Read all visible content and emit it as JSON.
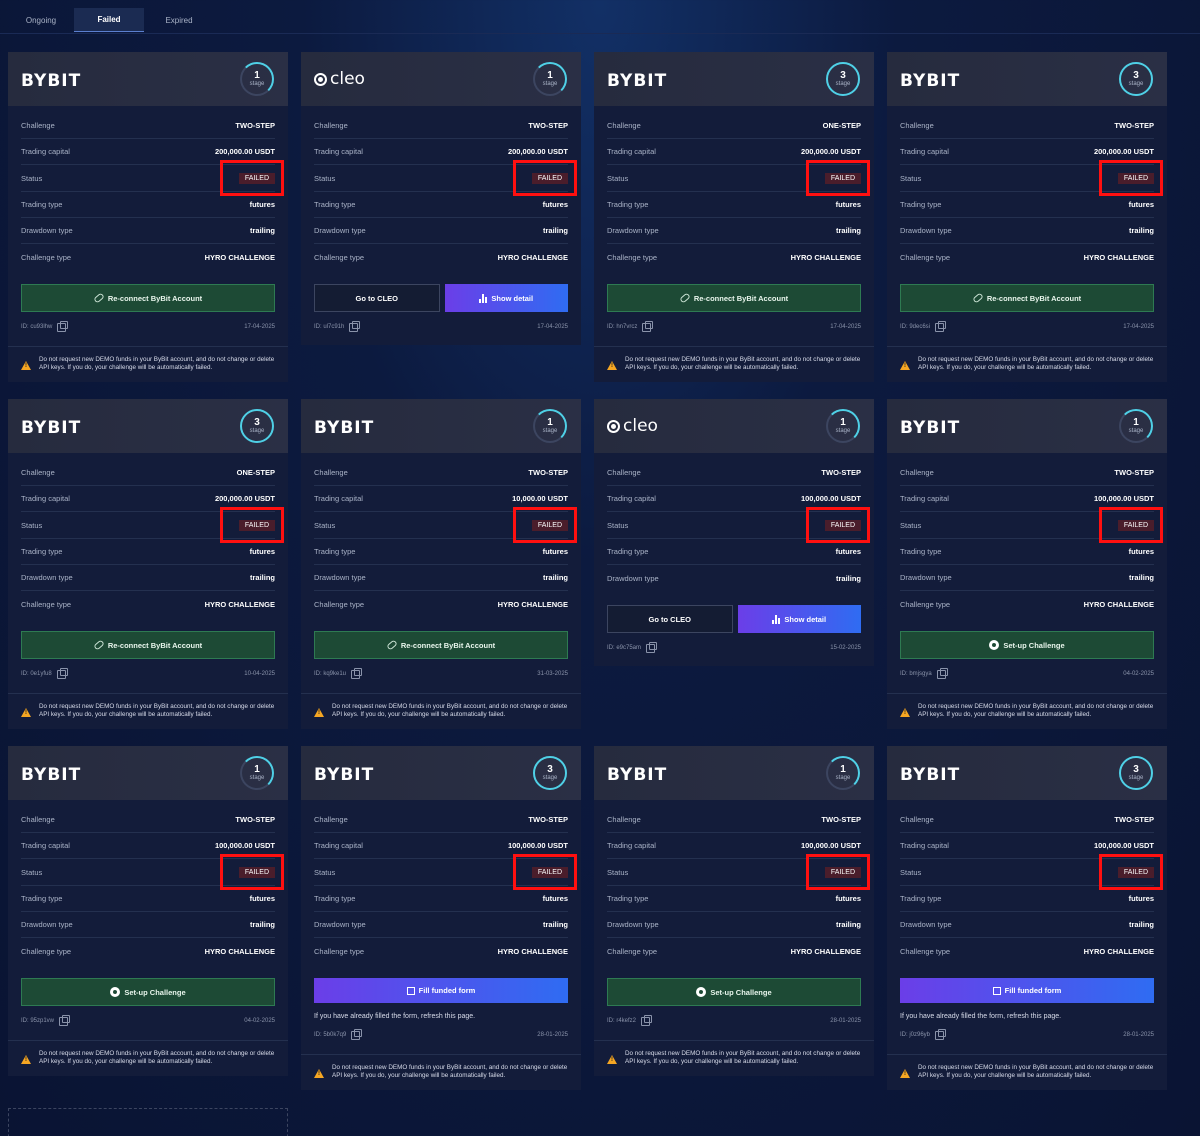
{
  "tabs": [
    "Ongoing",
    "Failed",
    "Expired"
  ],
  "active_tab": "Failed",
  "labels": {
    "stage": "stage",
    "challenge": "Challenge",
    "trading_capital": "Trading capital",
    "status": "Status",
    "trading_type": "Trading type",
    "drawdown_type": "Drawdown type",
    "challenge_type": "Challenge type",
    "warning": "Do not request new DEMO funds in your ByBit account, and do not change or delete API keys. If you do, your challenge will be automatically failed.",
    "funded_note": "If you have already filled the form, refresh this page."
  },
  "cards": [
    {
      "logo": "BYBIT",
      "stage": "1",
      "challenge": "TWO-STEP",
      "capital": "200,000.00 USDT",
      "status": "FAILED",
      "trading": "futures",
      "drawdown": "trailing",
      "ctype": "HYRO CHALLENGE",
      "action": "reconnect",
      "button": "Re-connect ByBit Account",
      "id": "ID: cu93lhw",
      "date": "17-04-2025"
    },
    {
      "logo": "cleo",
      "stage": "1",
      "challenge": "TWO-STEP",
      "capital": "200,000.00 USDT",
      "status": "FAILED",
      "trading": "futures",
      "drawdown": "trailing",
      "ctype": "HYRO CHALLENGE",
      "action": "cleo",
      "button": "Go to CLEO",
      "button2": "Show detail",
      "id": "ID: ul7c91h",
      "date": "17-04-2025"
    },
    {
      "logo": "BYBIT",
      "stage": "3",
      "challenge": "ONE-STEP",
      "capital": "200,000.00 USDT",
      "status": "FAILED",
      "trading": "futures",
      "drawdown": "trailing",
      "ctype": "HYRO CHALLENGE",
      "action": "reconnect",
      "button": "Re-connect ByBit Account",
      "id": "ID: hn7vrcz",
      "date": "17-04-2025"
    },
    {
      "logo": "BYBIT",
      "stage": "3",
      "challenge": "TWO-STEP",
      "capital": "200,000.00 USDT",
      "status": "FAILED",
      "trading": "futures",
      "drawdown": "trailing",
      "ctype": "HYRO CHALLENGE",
      "action": "reconnect",
      "button": "Re-connect ByBit Account",
      "id": "ID: 9dec6si",
      "date": "17-04-2025"
    },
    {
      "logo": "BYBIT",
      "stage": "3",
      "challenge": "ONE-STEP",
      "capital": "200,000.00 USDT",
      "status": "FAILED",
      "trading": "futures",
      "drawdown": "trailing",
      "ctype": "HYRO CHALLENGE",
      "action": "reconnect",
      "button": "Re-connect ByBit Account",
      "id": "ID: 0e1yfu8",
      "date": "10-04-2025"
    },
    {
      "logo": "BYBIT",
      "stage": "1",
      "challenge": "TWO-STEP",
      "capital": "10,000.00 USDT",
      "status": "FAILED",
      "trading": "futures",
      "drawdown": "trailing",
      "ctype": "HYRO CHALLENGE",
      "action": "reconnect",
      "button": "Re-connect ByBit Account",
      "id": "ID: kq9ke1u",
      "date": "31-03-2025"
    },
    {
      "logo": "cleo",
      "stage": "1",
      "challenge": "TWO-STEP",
      "capital": "100,000.00 USDT",
      "status": "FAILED",
      "trading": "futures",
      "drawdown": "trailing",
      "ctype": "",
      "action": "cleo",
      "button": "Go to CLEO",
      "button2": "Show detail",
      "id": "ID: e9c75am",
      "date": "15-02-2025"
    },
    {
      "logo": "BYBIT",
      "stage": "1",
      "challenge": "TWO-STEP",
      "capital": "100,000.00 USDT",
      "status": "FAILED",
      "trading": "futures",
      "drawdown": "trailing",
      "ctype": "HYRO CHALLENGE",
      "action": "setup",
      "button": "Set-up Challenge",
      "id": "ID: bmjsgya",
      "date": "04-02-2025"
    },
    {
      "logo": "BYBIT",
      "stage": "1",
      "challenge": "TWO-STEP",
      "capital": "100,000.00 USDT",
      "status": "FAILED",
      "trading": "futures",
      "drawdown": "trailing",
      "ctype": "HYRO CHALLENGE",
      "action": "setup",
      "button": "Set-up Challenge",
      "id": "ID: 95zp1vw",
      "date": "04-02-2025"
    },
    {
      "logo": "BYBIT",
      "stage": "3",
      "challenge": "TWO-STEP",
      "capital": "100,000.00 USDT",
      "status": "FAILED",
      "trading": "futures",
      "drawdown": "trailing",
      "ctype": "HYRO CHALLENGE",
      "action": "funded",
      "button": "Fill funded form",
      "id": "ID: 5b0k7q9",
      "date": "28-01-2025"
    },
    {
      "logo": "BYBIT",
      "stage": "1",
      "challenge": "TWO-STEP",
      "capital": "100,000.00 USDT",
      "status": "FAILED",
      "trading": "futures",
      "drawdown": "trailing",
      "ctype": "HYRO CHALLENGE",
      "action": "setup",
      "button": "Set-up Challenge",
      "id": "ID: r4kefz2",
      "date": "28-01-2025"
    },
    {
      "logo": "BYBIT",
      "stage": "3",
      "challenge": "TWO-STEP",
      "capital": "100,000.00 USDT",
      "status": "FAILED",
      "trading": "futures",
      "drawdown": "trailing",
      "ctype": "HYRO CHALLENGE",
      "action": "funded",
      "button": "Fill funded form",
      "id": "ID: j0z96yb",
      "date": "28-01-2025"
    }
  ],
  "colors": {
    "failed": "#ff4d4d",
    "highlight": "#ff1010",
    "green_button": "#1d4a35",
    "accent_ring": "#4fd0e6"
  }
}
